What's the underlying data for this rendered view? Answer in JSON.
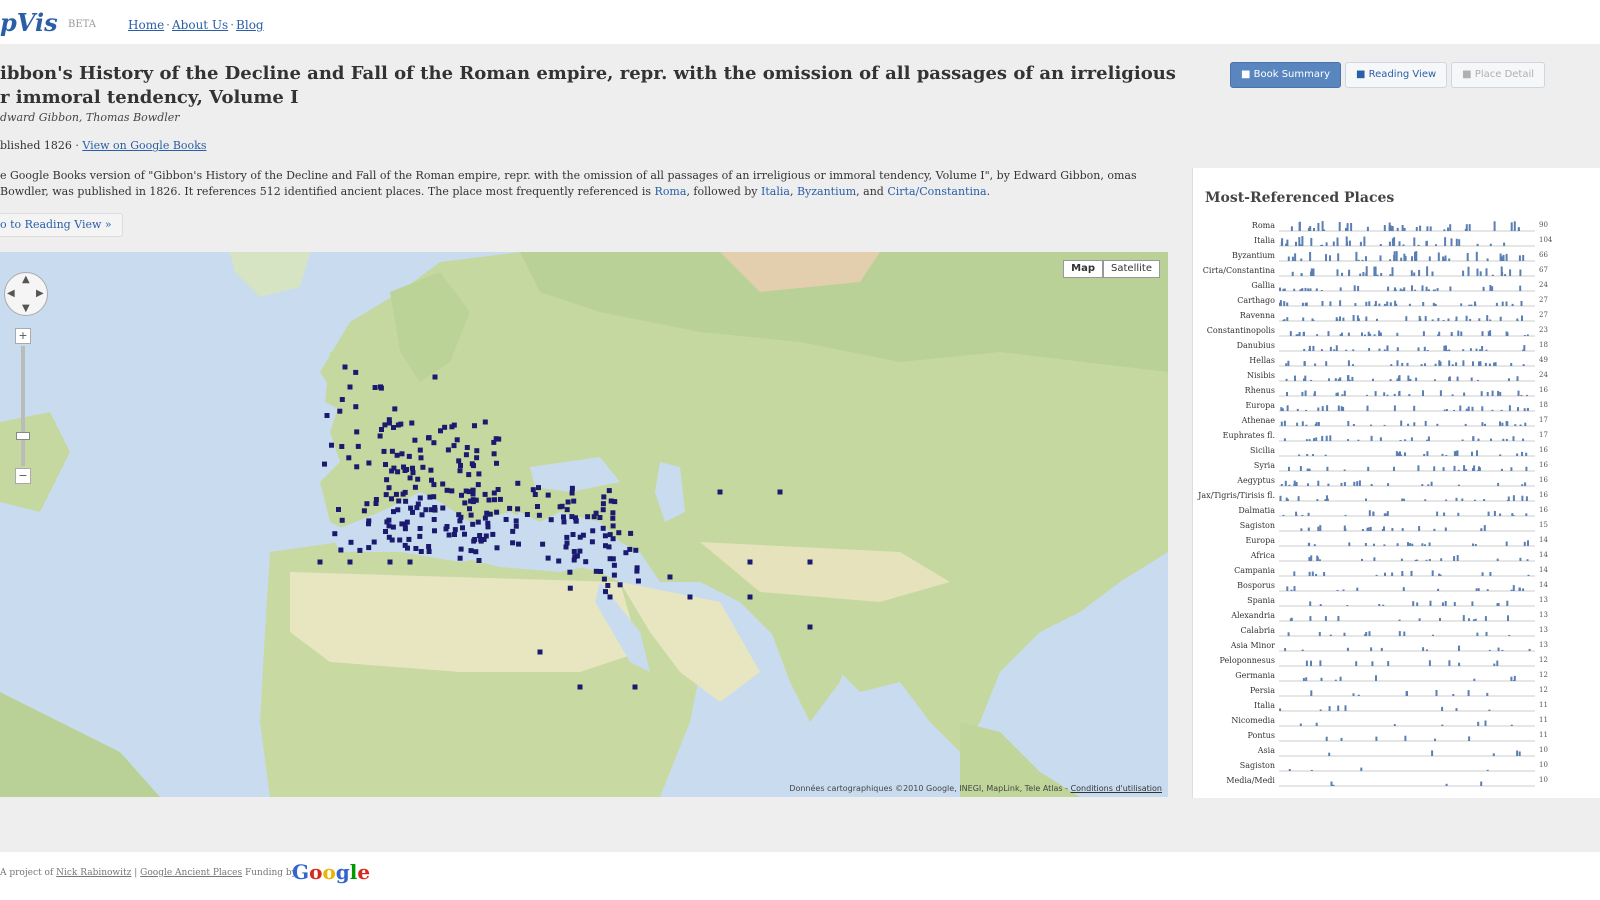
{
  "header": {
    "logo": "pVis",
    "beta": "BETA",
    "nav": [
      {
        "label": "Home"
      },
      {
        "label": "About Us"
      },
      {
        "label": "Blog"
      }
    ]
  },
  "book": {
    "title": "ibbon's History of the Decline and Fall of the Roman empire, repr. with the omission of all passages of an irreligious r immoral tendency, Volume I",
    "authors": "dward Gibbon, Thomas Bowdler",
    "published": "blished 1826 ·",
    "google_books_link": "View on Google Books",
    "summary_1": "e Google Books version of \"Gibbon's History of the Decline and Fall of the Roman empire, repr. with the omission of all passages of an irreligious or immoral tendency, Volume I\", by Edward Gibbon, omas Bowdler, was published in 1826. It references 512 identified ancient places. The place most frequently referenced is",
    "summary_place_1": "Roma",
    "summary_mid": ", followed by",
    "summary_place_2": "Italia",
    "summary_place_3": "Byzantium",
    "summary_and": ", and",
    "summary_place_4": "Cirta/Constantina",
    "summary_end": ".",
    "reading_link": "o to Reading View »"
  },
  "tabs": [
    {
      "label": "■ Book Summary",
      "state": "active"
    },
    {
      "label": "■ Reading View",
      "state": "normal"
    },
    {
      "label": "■ Place Detail",
      "state": "disabled"
    }
  ],
  "map": {
    "type_buttons": [
      {
        "label": "Map"
      },
      {
        "label": "Satellite"
      }
    ],
    "attribution": "Données cartographiques ©2010 Google, INEGI, MapLink, Tele Atlas -",
    "terms": "Conditions d'utilisation",
    "zoom_in": "+",
    "zoom_out": "−",
    "colors": {
      "water": "#c9dcef",
      "land": "#c7d9a4",
      "desert": "#e8e6c0",
      "marker": "#1a1a6e"
    }
  },
  "panel": {
    "title": "Most-Referenced Places",
    "places": [
      {
        "name": "Roma",
        "count": "90"
      },
      {
        "name": "Italia",
        "count": "104"
      },
      {
        "name": "Byzantium",
        "count": "66"
      },
      {
        "name": "Cirta/Constantina",
        "count": "67"
      },
      {
        "name": "Gallia",
        "count": "24"
      },
      {
        "name": "Carthago",
        "count": "27"
      },
      {
        "name": "Ravenna",
        "count": "27"
      },
      {
        "name": "Constantinopolis",
        "count": "23"
      },
      {
        "name": "Danubius",
        "count": "18"
      },
      {
        "name": "Hellas",
        "count": "49"
      },
      {
        "name": "Nisibis",
        "count": "24"
      },
      {
        "name": "Rhenus",
        "count": "16"
      },
      {
        "name": "Europa",
        "count": "18"
      },
      {
        "name": "Athenae",
        "count": "17"
      },
      {
        "name": "Euphrates fl.",
        "count": "17"
      },
      {
        "name": "Sicilia",
        "count": "16"
      },
      {
        "name": "Syria",
        "count": "16"
      },
      {
        "name": "Aegyptus",
        "count": "16"
      },
      {
        "name": "Jax/Tigris/Tirisis fl.",
        "count": "16"
      },
      {
        "name": "Dalmatia",
        "count": "16"
      },
      {
        "name": "Sagiston",
        "count": "15"
      },
      {
        "name": "Europa",
        "count": "14"
      },
      {
        "name": "Africa",
        "count": "14"
      },
      {
        "name": "Campania",
        "count": "14"
      },
      {
        "name": "Bosporus",
        "count": "14"
      },
      {
        "name": "Spania",
        "count": "13"
      },
      {
        "name": "Alexandria",
        "count": "13"
      },
      {
        "name": "Calabria",
        "count": "13"
      },
      {
        "name": "Asia Minor",
        "count": "13"
      },
      {
        "name": "Peloponnesus",
        "count": "12"
      },
      {
        "name": "Germania",
        "count": "12"
      },
      {
        "name": "Persia",
        "count": "12"
      },
      {
        "name": "Italia",
        "count": "11"
      },
      {
        "name": "Nicomedia",
        "count": "11"
      },
      {
        "name": "Pontus",
        "count": "11"
      },
      {
        "name": "Asia",
        "count": "10"
      },
      {
        "name": "Sagiston",
        "count": "10"
      },
      {
        "name": "Media/Medi",
        "count": "10"
      }
    ]
  },
  "footer": {
    "text": "A project of",
    "link1": "Nick Rabinowitz",
    "sep": "|",
    "link2": "Google Ancient Places",
    "funded": "Funding by",
    "google": "Google"
  }
}
